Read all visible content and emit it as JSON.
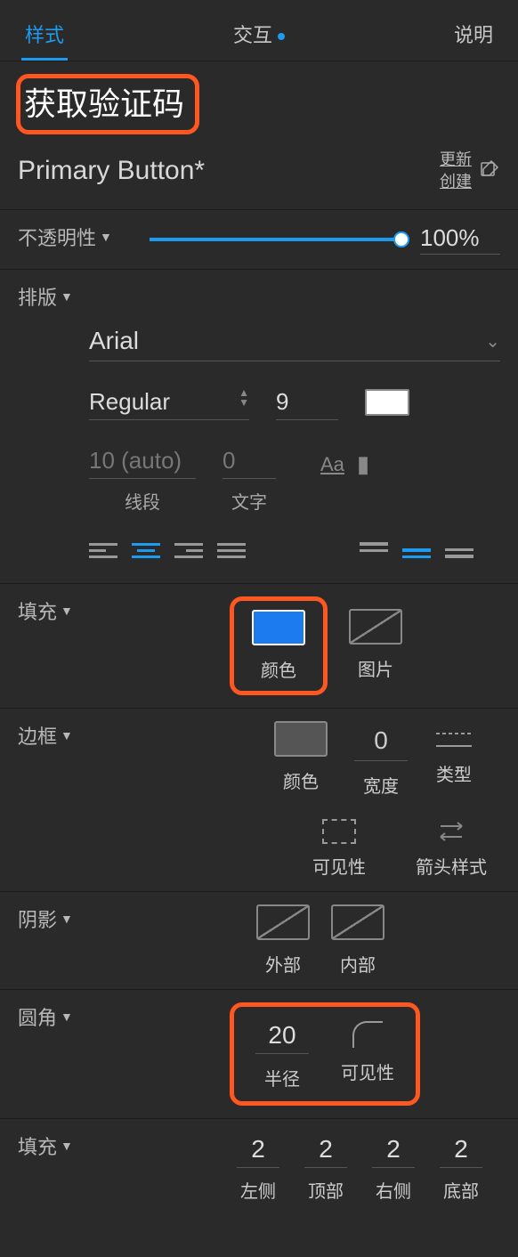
{
  "tabs": {
    "style": "样式",
    "interaction": "交互",
    "notes": "说明"
  },
  "element_name": "获取验证码",
  "style_name": "Primary Button*",
  "style_links": {
    "update": "更新",
    "create": "创建"
  },
  "opacity": {
    "label": "不透明性",
    "value": "100%"
  },
  "typography": {
    "label": "排版",
    "font": "Arial",
    "weight": "Regular",
    "size": "9",
    "line_val": "10 (auto)",
    "line_lbl": "线段",
    "char_val": "0",
    "char_lbl": "文字"
  },
  "fill": {
    "label": "填充",
    "color_lbl": "颜色",
    "image_lbl": "图片"
  },
  "border": {
    "label": "边框",
    "color_lbl": "颜色",
    "width_val": "0",
    "width_lbl": "宽度",
    "type_lbl": "类型",
    "visibility_lbl": "可见性",
    "arrow_lbl": "箭头样式"
  },
  "shadow": {
    "label": "阴影",
    "outer_lbl": "外部",
    "inner_lbl": "内部"
  },
  "corner": {
    "label": "圆角",
    "radius_val": "20",
    "radius_lbl": "半径",
    "visibility_lbl": "可见性"
  },
  "padding": {
    "label": "填充",
    "left_val": "2",
    "left_lbl": "左侧",
    "top_val": "2",
    "top_lbl": "顶部",
    "right_val": "2",
    "right_lbl": "右侧",
    "bottom_val": "2",
    "bottom_lbl": "底部"
  }
}
